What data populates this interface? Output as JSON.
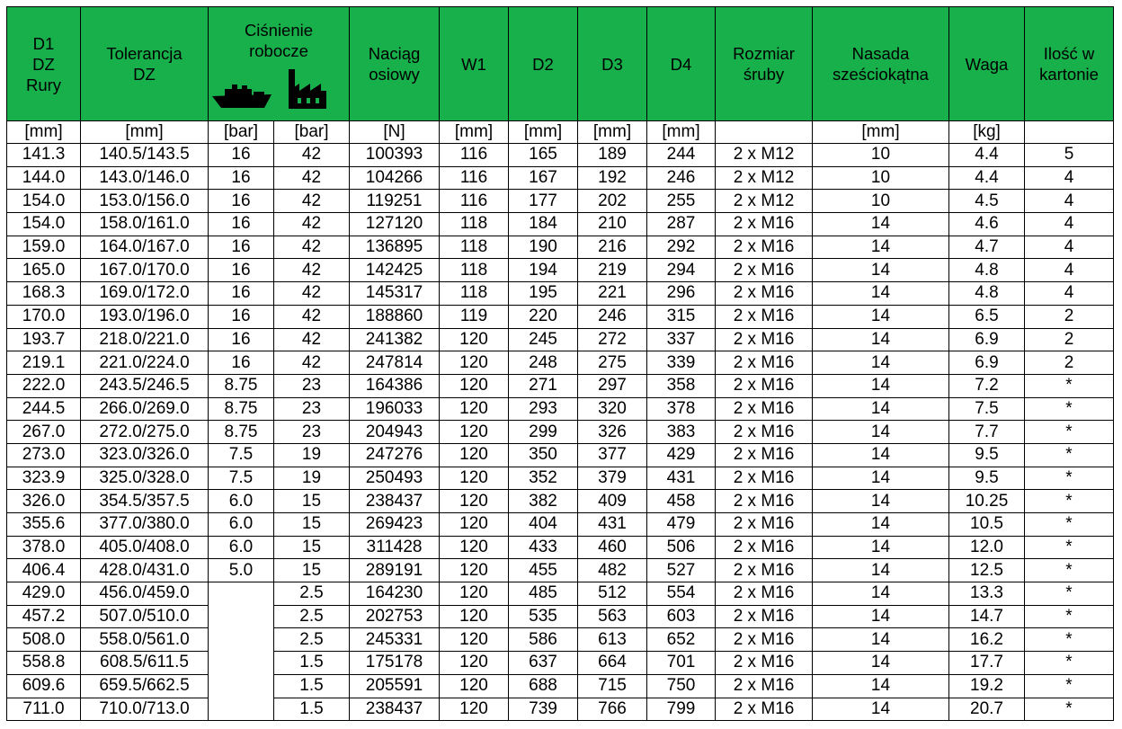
{
  "headers": {
    "d1": "D1\nDZ\nRury",
    "tol": "Tolerancja\nDZ",
    "pressure": "Ciśnienie\nrobocze",
    "pull": "Naciąg\nosiowy",
    "w1": "W1",
    "d2": "D2",
    "d3": "D3",
    "d4": "D4",
    "bolt": "Rozmiar\nśruby",
    "hex": "Nasada\nsześciokątna",
    "weight": "Waga",
    "qty": "Ilość w\nkartonie"
  },
  "icons": {
    "ship": "ship-icon",
    "factory": "factory-icon"
  },
  "colors": {
    "header_bg": "#17b04a"
  },
  "units": [
    "[mm]",
    "[mm]",
    "[bar]",
    "[bar]",
    "[N]",
    "[mm]",
    "[mm]",
    "[mm]",
    "[mm]",
    "",
    "[mm]",
    "[kg]",
    ""
  ],
  "rows": [
    [
      "141.3",
      "140.5/143.5",
      "16",
      "42",
      "100393",
      "116",
      "165",
      "189",
      "244",
      "2 x M12",
      "10",
      "4.4",
      "5"
    ],
    [
      "144.0",
      "143.0/146.0",
      "16",
      "42",
      "104266",
      "116",
      "167",
      "192",
      "246",
      "2 x M12",
      "10",
      "4.4",
      "4"
    ],
    [
      "154.0",
      "153.0/156.0",
      "16",
      "42",
      "119251",
      "116",
      "177",
      "202",
      "255",
      "2 x M12",
      "10",
      "4.5",
      "4"
    ],
    [
      "154.0",
      "158.0/161.0",
      "16",
      "42",
      "127120",
      "118",
      "184",
      "210",
      "287",
      "2 x M16",
      "14",
      "4.6",
      "4"
    ],
    [
      "159.0",
      "164.0/167.0",
      "16",
      "42",
      "136895",
      "118",
      "190",
      "216",
      "292",
      "2 x M16",
      "14",
      "4.7",
      "4"
    ],
    [
      "165.0",
      "167.0/170.0",
      "16",
      "42",
      "142425",
      "118",
      "194",
      "219",
      "294",
      "2 x M16",
      "14",
      "4.8",
      "4"
    ],
    [
      "168.3",
      "169.0/172.0",
      "16",
      "42",
      "145317",
      "118",
      "195",
      "221",
      "296",
      "2 x M16",
      "14",
      "4.8",
      "4"
    ],
    [
      "170.0",
      "193.0/196.0",
      "16",
      "42",
      "188860",
      "119",
      "220",
      "246",
      "315",
      "2 x M16",
      "14",
      "6.5",
      "2"
    ],
    [
      "193.7",
      "218.0/221.0",
      "16",
      "42",
      "241382",
      "120",
      "245",
      "272",
      "337",
      "2 x M16",
      "14",
      "6.9",
      "2"
    ],
    [
      "219.1",
      "221.0/224.0",
      "16",
      "42",
      "247814",
      "120",
      "248",
      "275",
      "339",
      "2 x M16",
      "14",
      "6.9",
      "2"
    ],
    [
      "222.0",
      "243.5/246.5",
      "8.75",
      "23",
      "164386",
      "120",
      "271",
      "297",
      "358",
      "2 x M16",
      "14",
      "7.2",
      "*"
    ],
    [
      "244.5",
      "266.0/269.0",
      "8.75",
      "23",
      "196033",
      "120",
      "293",
      "320",
      "378",
      "2 x M16",
      "14",
      "7.5",
      "*"
    ],
    [
      "267.0",
      "272.0/275.0",
      "8.75",
      "23",
      "204943",
      "120",
      "299",
      "326",
      "383",
      "2 x M16",
      "14",
      "7.7",
      "*"
    ],
    [
      "273.0",
      "323.0/326.0",
      "7.5",
      "19",
      "247276",
      "120",
      "350",
      "377",
      "429",
      "2 x M16",
      "14",
      "9.5",
      "*"
    ],
    [
      "323.9",
      "325.0/328.0",
      "7.5",
      "19",
      "250493",
      "120",
      "352",
      "379",
      "431",
      "2 x M16",
      "14",
      "9.5",
      "*"
    ],
    [
      "326.0",
      "354.5/357.5",
      "6.0",
      "15",
      "238437",
      "120",
      "382",
      "409",
      "458",
      "2 x M16",
      "14",
      "10.25",
      "*"
    ],
    [
      "355.6",
      "377.0/380.0",
      "6.0",
      "15",
      "269423",
      "120",
      "404",
      "431",
      "479",
      "2 x M16",
      "14",
      "10.5",
      "*"
    ],
    [
      "378.0",
      "405.0/408.0",
      "6.0",
      "15",
      "311428",
      "120",
      "433",
      "460",
      "506",
      "2 x M16",
      "14",
      "12.0",
      "*"
    ],
    [
      "406.4",
      "428.0/431.0",
      "5.0",
      "15",
      "289191",
      "120",
      "455",
      "482",
      "527",
      "2 x M16",
      "14",
      "12.5",
      "*"
    ],
    [
      "429.0",
      "456.0/459.0",
      "",
      "2.5",
      "164230",
      "120",
      "485",
      "512",
      "554",
      "2 x M16",
      "14",
      "13.3",
      "*"
    ],
    [
      "457.2",
      "507.0/510.0",
      "",
      "2.5",
      "202753",
      "120",
      "535",
      "563",
      "603",
      "2 x M16",
      "14",
      "14.7",
      "*"
    ],
    [
      "508.0",
      "558.0/561.0",
      "",
      "2.5",
      "245331",
      "120",
      "586",
      "613",
      "652",
      "2 x M16",
      "14",
      "16.2",
      "*"
    ],
    [
      "558.8",
      "608.5/611.5",
      "",
      "1.5",
      "175178",
      "120",
      "637",
      "664",
      "701",
      "2 x M16",
      "14",
      "17.7",
      "*"
    ],
    [
      "609.6",
      "659.5/662.5",
      "",
      "1.5",
      "205591",
      "120",
      "688",
      "715",
      "750",
      "2 x M16",
      "14",
      "19.2",
      "*"
    ],
    [
      "711.0",
      "710.0/713.0",
      "",
      "1.5",
      "238437",
      "120",
      "739",
      "766",
      "799",
      "2 x M16",
      "14",
      "20.7",
      "*"
    ]
  ]
}
